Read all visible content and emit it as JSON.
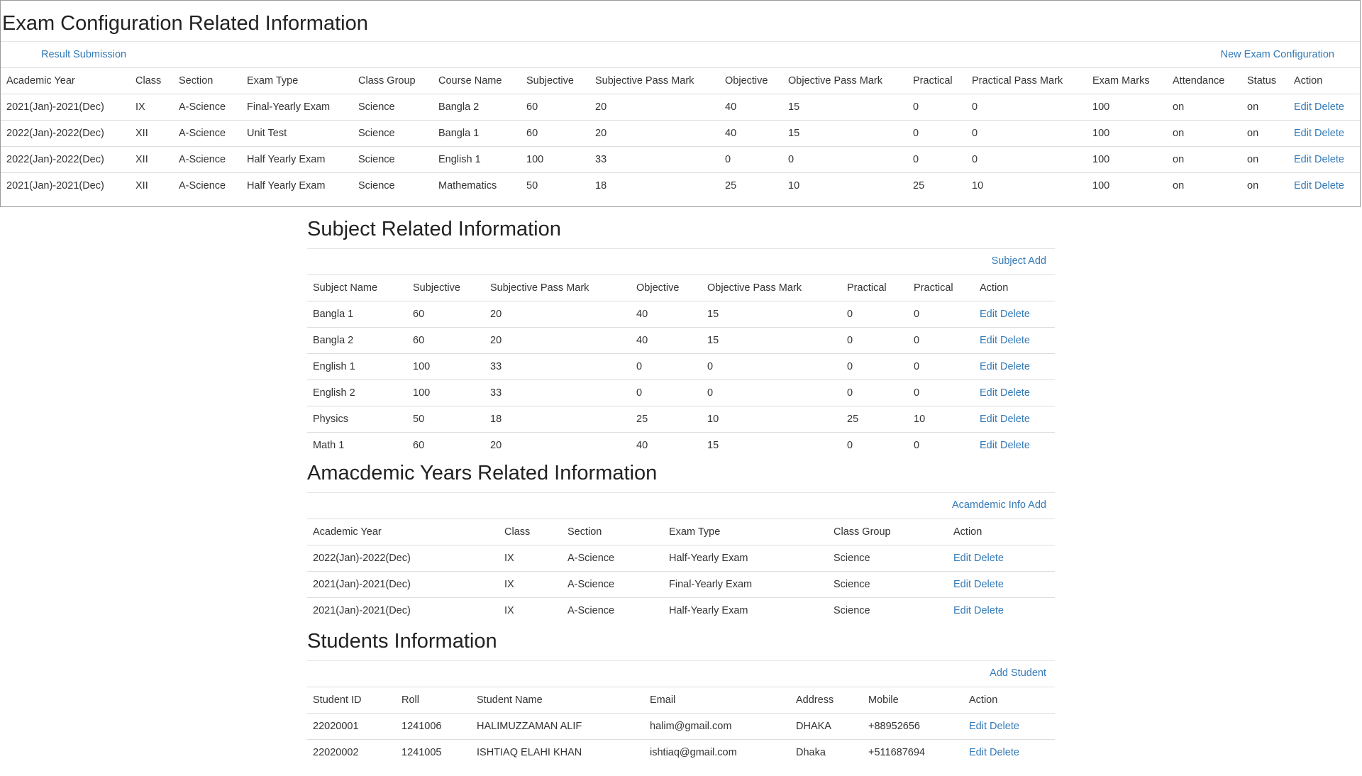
{
  "exam": {
    "title": "Exam Configuration Related Information",
    "result_link": "Result Submission",
    "new_link": "New Exam Configuration",
    "headers": [
      "Academic Year",
      "Class",
      "Section",
      "Exam Type",
      "Class Group",
      "Course Name",
      "Subjective",
      "Subjective Pass Mark",
      "Objective",
      "Objective Pass Mark",
      "Practical",
      "Practical Pass Mark",
      "Exam Marks",
      "Attendance",
      "Status",
      "Action"
    ],
    "rows": [
      [
        "2021(Jan)-2021(Dec)",
        "IX",
        "A-Science",
        "Final-Yearly Exam",
        "Science",
        "Bangla 2",
        "60",
        "20",
        "40",
        "15",
        "0",
        "0",
        "100",
        "on",
        "on"
      ],
      [
        "2022(Jan)-2022(Dec)",
        "XII",
        "A-Science",
        "Unit Test",
        "Science",
        "Bangla 1",
        "60",
        "20",
        "40",
        "15",
        "0",
        "0",
        "100",
        "on",
        "on"
      ],
      [
        "2022(Jan)-2022(Dec)",
        "XII",
        "A-Science",
        "Half Yearly Exam",
        "Science",
        "English 1",
        "100",
        "33",
        "0",
        "0",
        "0",
        "0",
        "100",
        "on",
        "on"
      ],
      [
        "2021(Jan)-2021(Dec)",
        "XII",
        "A-Science",
        "Half Yearly Exam",
        "Science",
        "Mathematics",
        "50",
        "18",
        "25",
        "10",
        "25",
        "10",
        "100",
        "on",
        "on"
      ]
    ],
    "edit": "Edit",
    "delete": "Delete"
  },
  "subject": {
    "title": "Subject Related Information",
    "add_link": "Subject Add",
    "headers": [
      "Subject Name",
      "Subjective",
      "Subjective Pass Mark",
      "Objective",
      "Objective Pass Mark",
      "Practical",
      "Practical",
      "Action"
    ],
    "rows": [
      [
        "Bangla 1",
        "60",
        "20",
        "40",
        "15",
        "0",
        "0"
      ],
      [
        "Bangla 2",
        "60",
        "20",
        "40",
        "15",
        "0",
        "0"
      ],
      [
        "English 1",
        "100",
        "33",
        "0",
        "0",
        "0",
        "0"
      ],
      [
        "English 2",
        "100",
        "33",
        "0",
        "0",
        "0",
        "0"
      ],
      [
        "Physics",
        "50",
        "18",
        "25",
        "10",
        "25",
        "10"
      ],
      [
        "Math 1",
        "60",
        "20",
        "40",
        "15",
        "0",
        "0"
      ]
    ],
    "edit": "Edit",
    "delete": "Delete"
  },
  "academic": {
    "title": "Amacdemic Years Related Information",
    "add_link": "Acamdemic Info Add",
    "headers": [
      "Academic Year",
      "Class",
      "Section",
      "Exam Type",
      "Class Group",
      "Action"
    ],
    "rows": [
      [
        "2022(Jan)-2022(Dec)",
        "IX",
        "A-Science",
        "Half-Yearly Exam",
        "Science"
      ],
      [
        "2021(Jan)-2021(Dec)",
        "IX",
        "A-Science",
        "Final-Yearly Exam",
        "Science"
      ],
      [
        "2021(Jan)-2021(Dec)",
        "IX",
        "A-Science",
        "Half-Yearly Exam",
        "Science"
      ]
    ],
    "edit": "Edit",
    "delete": "Delete"
  },
  "students": {
    "title": "Students Information",
    "add_link": "Add Student",
    "headers": [
      "Student ID",
      "Roll",
      "Student Name",
      "Email",
      "Address",
      "Mobile",
      "Action"
    ],
    "rows": [
      [
        "22020001",
        "1241006",
        "HALIMUZZAMAN ALIF",
        "halim@gmail.com",
        "DHAKA",
        "+88952656"
      ],
      [
        "22020002",
        "1241005",
        "ISHTIAQ ELAHI KHAN",
        "ishtiaq@gmail.com",
        "Dhaka",
        "+511687694"
      ]
    ],
    "edit": "Edit",
    "delete": "Delete"
  },
  "colors": {
    "link": "#337ab7",
    "text": "#333333",
    "border": "#dddddd"
  }
}
